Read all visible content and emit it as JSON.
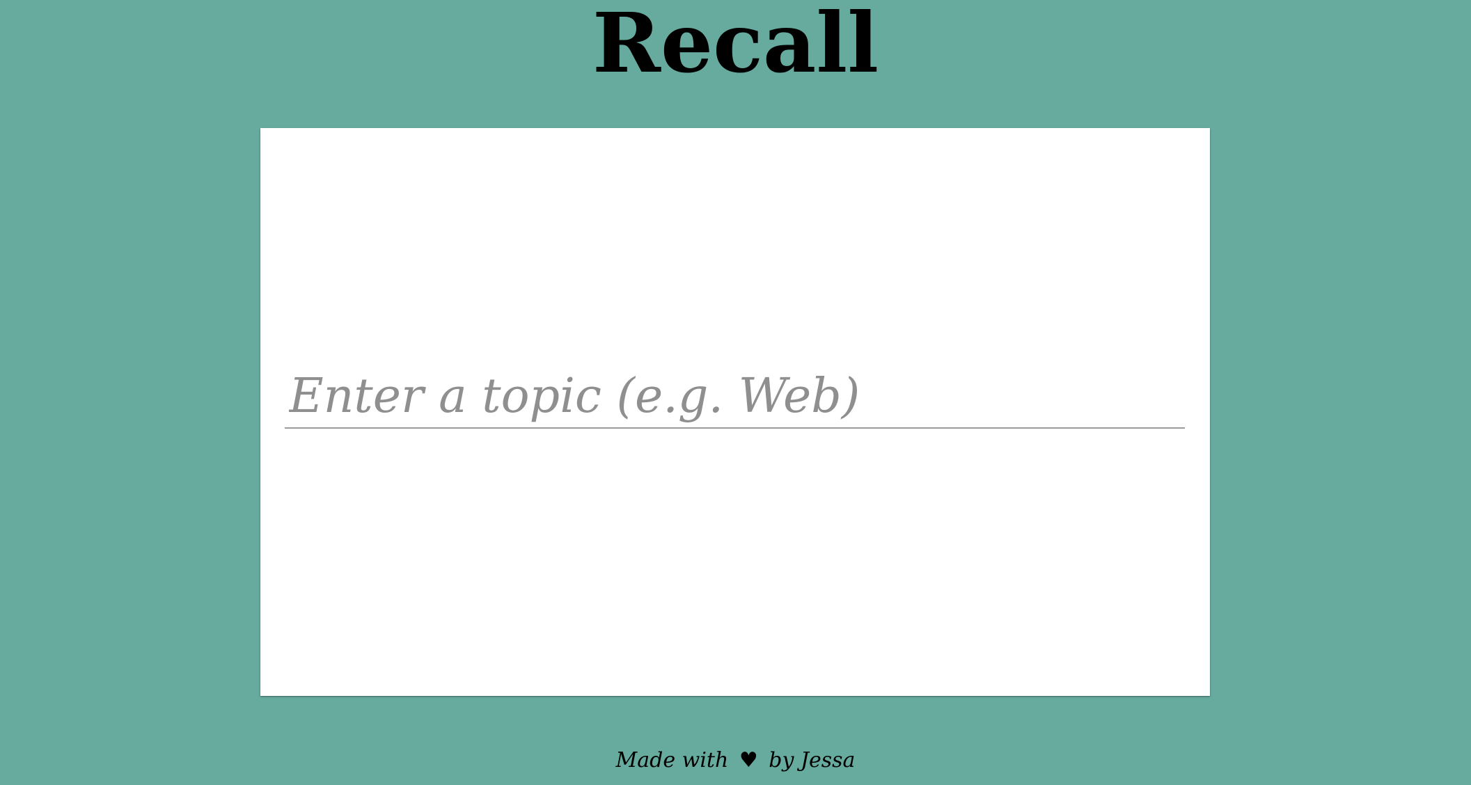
{
  "app": {
    "title": "Recall"
  },
  "topic_input": {
    "placeholder": "Enter a topic (e.g. Web)",
    "value": ""
  },
  "footer": {
    "made_with": "Made with",
    "heart": "♥",
    "by": "by Jessa"
  },
  "colors": {
    "background": "#67ab9f",
    "card": "#ffffff",
    "placeholder": "#8f8f8f",
    "underline": "#9a9a9a"
  }
}
